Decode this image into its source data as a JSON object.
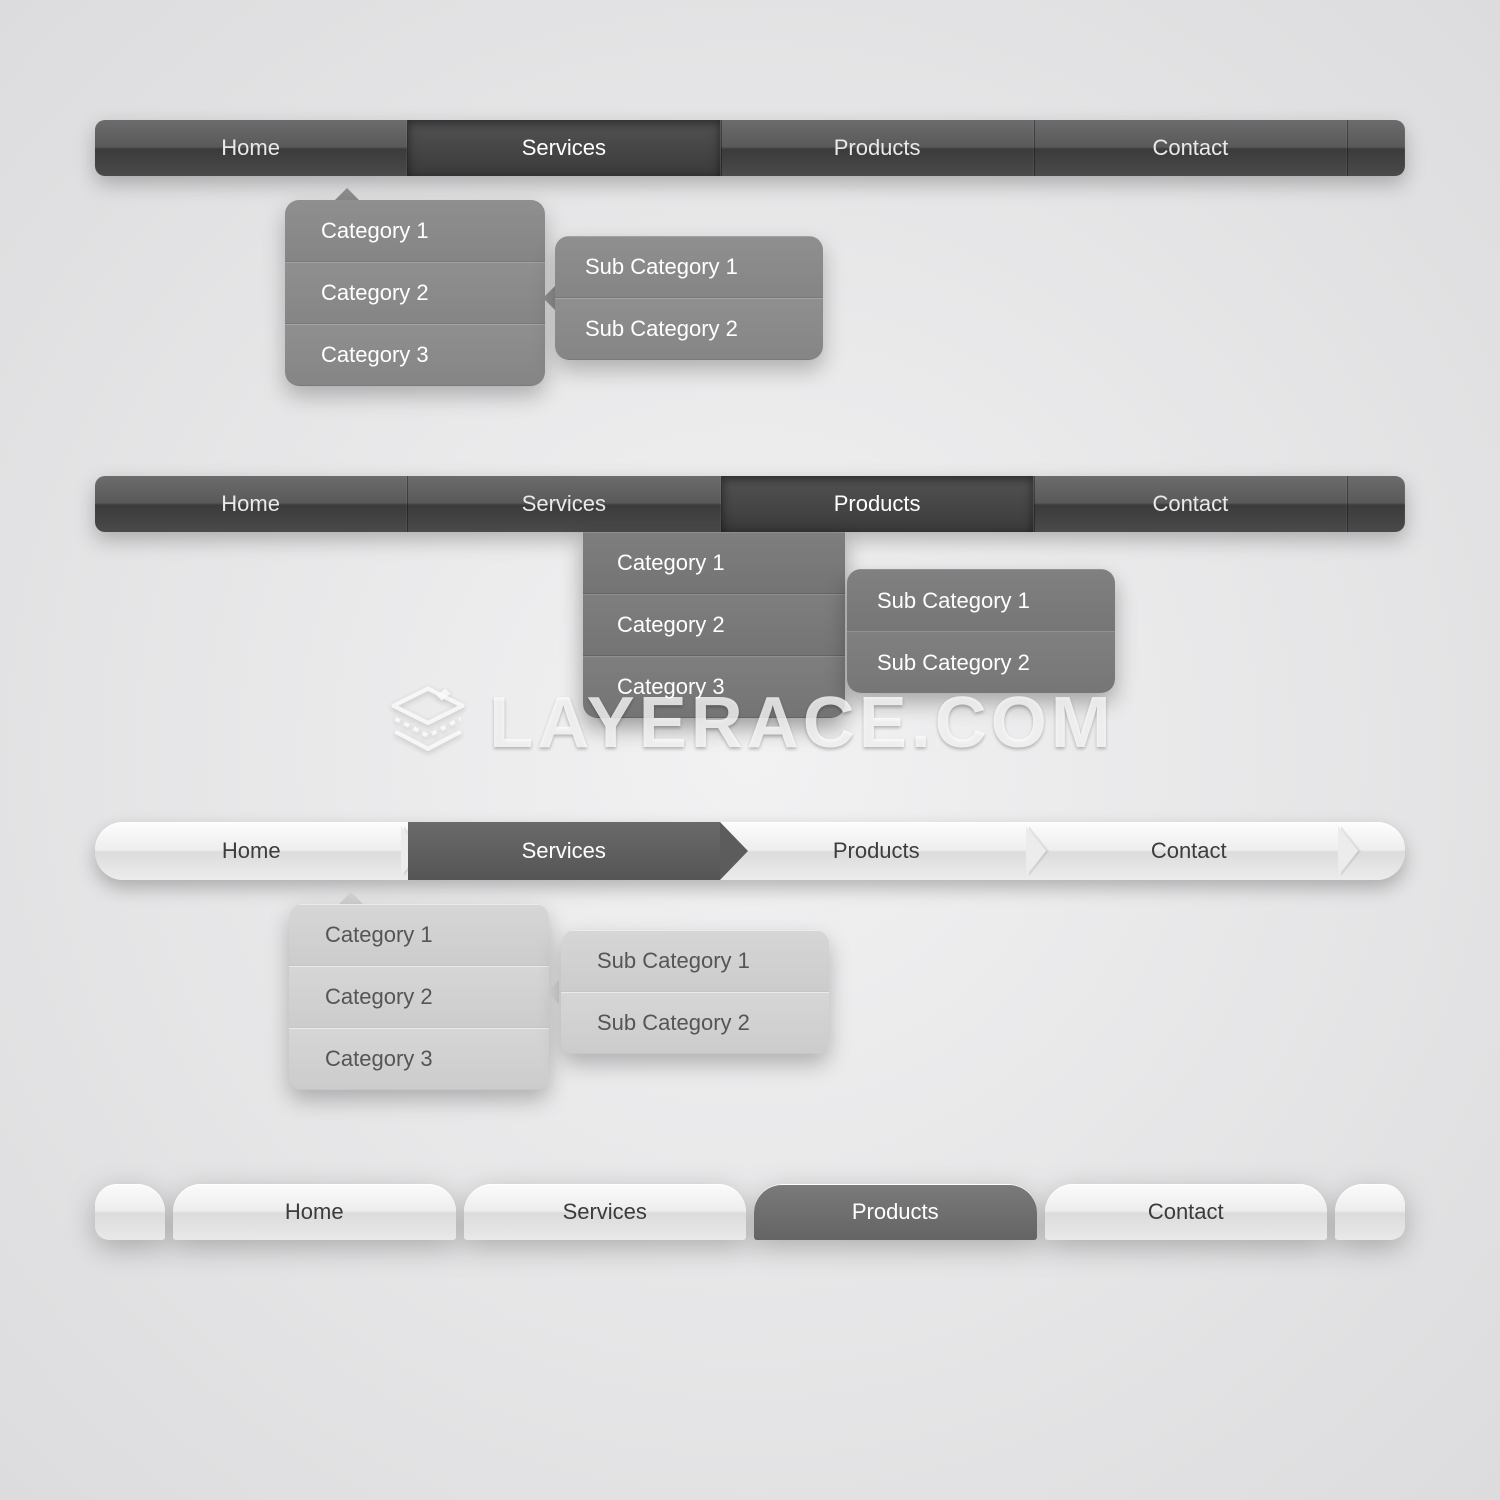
{
  "watermark": "LAYERACE.COM",
  "navs": [
    {
      "style": "dark-bar",
      "active_index": 1,
      "items": [
        "Home",
        "Services",
        "Products",
        "Contact"
      ],
      "dropdown": {
        "parent_index": 1,
        "items": [
          "Category 1",
          "Category 2",
          "Category 3"
        ]
      },
      "flyout": {
        "parent_dropdown_index": 1,
        "items": [
          "Sub Category 1",
          "Sub Category 2"
        ]
      }
    },
    {
      "style": "dark-bar",
      "active_index": 2,
      "items": [
        "Home",
        "Services",
        "Products",
        "Contact"
      ],
      "dropdown": {
        "parent_index": 2,
        "items": [
          "Category 1",
          "Category 2",
          "Category 3"
        ]
      },
      "flyout": {
        "parent_dropdown_index": 0,
        "items": [
          "Sub Category 1",
          "Sub Category 2"
        ]
      }
    },
    {
      "style": "light-arrow",
      "active_index": 1,
      "items": [
        "Home",
        "Services",
        "Products",
        "Contact"
      ],
      "dropdown": {
        "parent_index": 1,
        "items": [
          "Category 1",
          "Category 2",
          "Category 3"
        ]
      },
      "flyout": {
        "parent_dropdown_index": 1,
        "items": [
          "Sub Category 1",
          "Sub Category 2"
        ]
      }
    },
    {
      "style": "light-tabs",
      "active_index": 2,
      "items": [
        "Home",
        "Services",
        "Products",
        "Contact"
      ]
    }
  ]
}
